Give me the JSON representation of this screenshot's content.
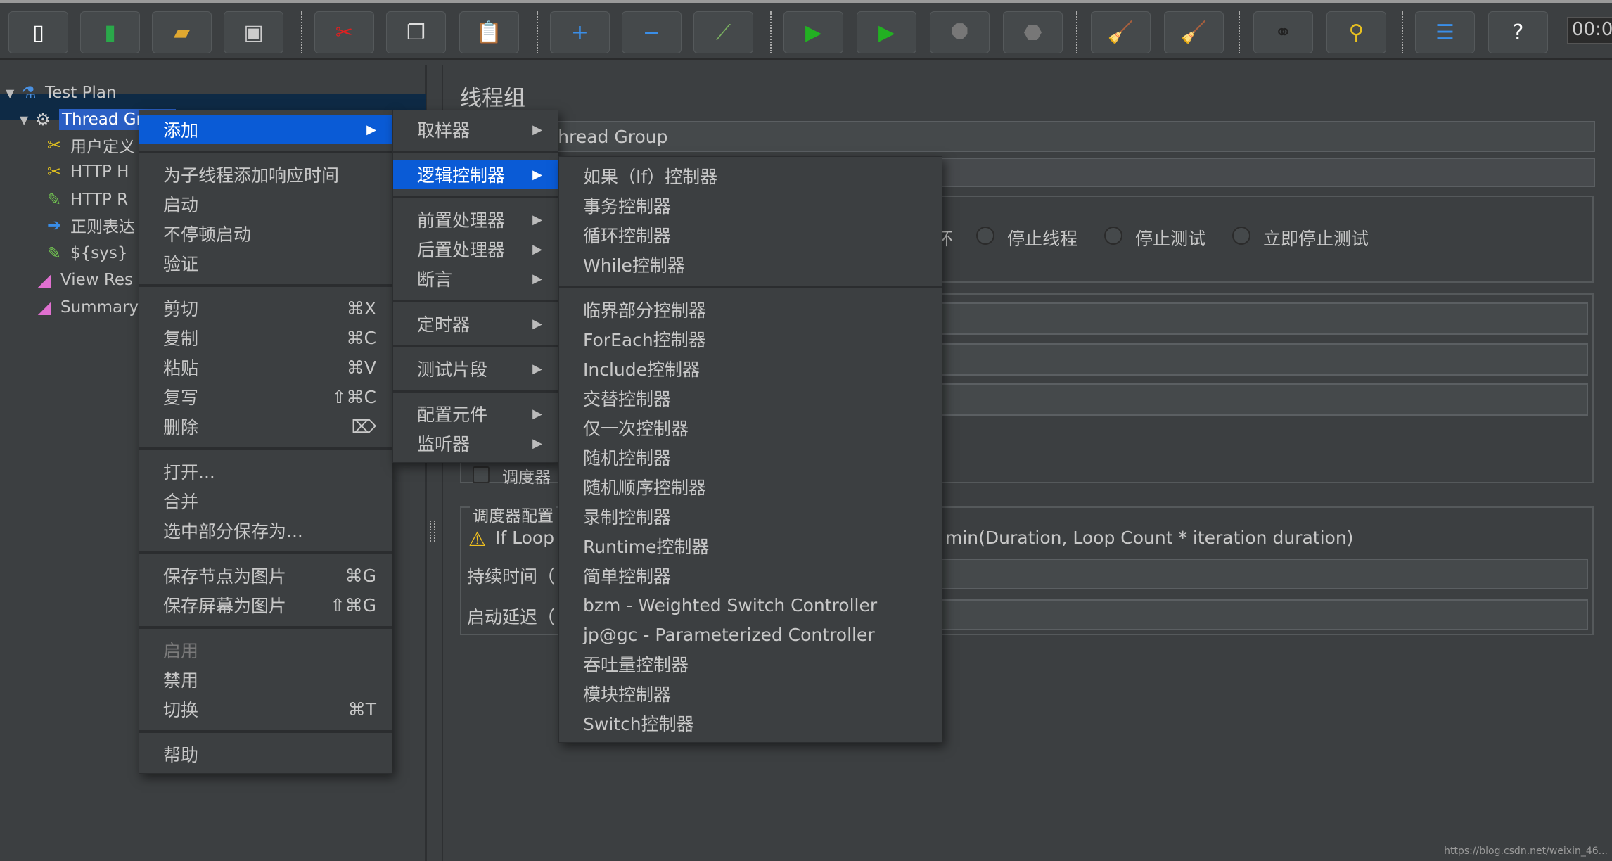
{
  "toolbar": {
    "buttons": [
      {
        "icon": "new-document-icon",
        "glyph": "▯",
        "color": "#ffffff"
      },
      {
        "icon": "templates-icon",
        "glyph": "▮",
        "color": "#2aa84a"
      },
      {
        "icon": "open-folder-icon",
        "glyph": "▰",
        "color": "#e0a830"
      },
      {
        "icon": "save-icon",
        "glyph": "▣",
        "color": "#cccccc"
      },
      {
        "icon": "cut-icon",
        "glyph": "✂",
        "color": "#e02020"
      },
      {
        "icon": "copy-icon",
        "glyph": "❐",
        "color": "#dddddd"
      },
      {
        "icon": "paste-icon",
        "glyph": "📋",
        "color": "#d08030"
      },
      {
        "icon": "expand-icon",
        "glyph": "+",
        "color": "#3a8ee8"
      },
      {
        "icon": "collapse-icon",
        "glyph": "−",
        "color": "#3a8ee8"
      },
      {
        "icon": "toggle-icon",
        "glyph": "⟋",
        "color": "#7ab060"
      },
      {
        "icon": "start-icon",
        "glyph": "▶",
        "color": "#22b022"
      },
      {
        "icon": "start-no-pause-icon",
        "glyph": "▶",
        "color": "#22b022"
      },
      {
        "icon": "stop-icon",
        "glyph": "⯃",
        "color": "#777777"
      },
      {
        "icon": "shutdown-icon",
        "glyph": "⬣",
        "color": "#777777"
      },
      {
        "icon": "clear-icon",
        "glyph": "🧹",
        "color": "#c0a070"
      },
      {
        "icon": "clear-all-icon",
        "glyph": "🧹",
        "color": "#c0a070"
      },
      {
        "icon": "search-binoculars-icon",
        "glyph": "⚭",
        "color": "#222222"
      },
      {
        "icon": "reset-search-broom-icon",
        "glyph": "⚲",
        "color": "#e8c020"
      },
      {
        "icon": "function-helper-icon",
        "glyph": "☰",
        "color": "#3a8ee8"
      },
      {
        "icon": "help-icon",
        "glyph": "?",
        "color": "#ffffff"
      }
    ],
    "timer": "00:0"
  },
  "tree": {
    "items": [
      {
        "label": "Test Plan",
        "icon": "test-plan-flask-icon"
      },
      {
        "label": "Thread Group",
        "icon": "thread-group-gear-icon"
      },
      {
        "label": "用户定义",
        "icon": "config-tools-icon"
      },
      {
        "label": "HTTP H",
        "icon": "config-tools-icon"
      },
      {
        "label": "HTTP R",
        "icon": "sampler-pipette-icon"
      },
      {
        "label": "正则表达",
        "icon": "post-processor-icon"
      },
      {
        "label": "${sys}",
        "icon": "sampler-pipette-icon"
      },
      {
        "label": "View Res",
        "icon": "listener-chart-icon"
      },
      {
        "label": "Summary",
        "icon": "listener-chart-icon"
      }
    ]
  },
  "panel": {
    "title": "线程组",
    "name_value": "Thread Group",
    "on_error_partial": "环",
    "on_error_options": [
      "停止线程",
      "停止测试",
      "立即停止测试"
    ],
    "scheduler_checkbox": "调度器",
    "scheduler_section_title": "调度器配置",
    "warning_start": "If Loop",
    "warning_end": "min(Duration, Loop Count * iteration duration)",
    "duration_label": "持续时间（",
    "delay_label": "启动延迟（"
  },
  "context_menu": {
    "groups": [
      [
        {
          "label": "添加",
          "submenu": true,
          "highlighted": true
        }
      ],
      [
        {
          "label": "为子线程添加响应时间"
        },
        {
          "label": "启动"
        },
        {
          "label": "不停顿启动"
        },
        {
          "label": "验证"
        }
      ],
      [
        {
          "label": "剪切",
          "shortcut": "⌘X"
        },
        {
          "label": "复制",
          "shortcut": "⌘C"
        },
        {
          "label": "粘贴",
          "shortcut": "⌘V"
        },
        {
          "label": "复写",
          "shortcut": "⇧⌘C"
        },
        {
          "label": "删除",
          "shortcut": "⌦"
        }
      ],
      [
        {
          "label": "打开..."
        },
        {
          "label": "合并"
        },
        {
          "label": "选中部分保存为..."
        }
      ],
      [
        {
          "label": "保存节点为图片",
          "shortcut": "⌘G"
        },
        {
          "label": "保存屏幕为图片",
          "shortcut": "⇧⌘G"
        }
      ],
      [
        {
          "label": "启用",
          "disabled": true
        },
        {
          "label": "禁用"
        },
        {
          "label": "切换",
          "shortcut": "⌘T"
        }
      ],
      [
        {
          "label": "帮助"
        }
      ]
    ]
  },
  "add_submenu": {
    "groups": [
      [
        {
          "label": "取样器",
          "submenu": true
        }
      ],
      [
        {
          "label": "逻辑控制器",
          "submenu": true,
          "highlighted": true
        }
      ],
      [
        {
          "label": "前置处理器",
          "submenu": true
        },
        {
          "label": "后置处理器",
          "submenu": true
        },
        {
          "label": "断言",
          "submenu": true
        }
      ],
      [
        {
          "label": "定时器",
          "submenu": true
        }
      ],
      [
        {
          "label": "测试片段",
          "submenu": true
        }
      ],
      [
        {
          "label": "配置元件",
          "submenu": true
        },
        {
          "label": "监听器",
          "submenu": true
        }
      ]
    ]
  },
  "logic_submenu": {
    "groups": [
      [
        {
          "label": "如果（If）控制器"
        },
        {
          "label": "事务控制器"
        },
        {
          "label": "循环控制器"
        },
        {
          "label": "While控制器"
        }
      ],
      [
        {
          "label": "临界部分控制器"
        },
        {
          "label": "ForEach控制器"
        },
        {
          "label": "Include控制器"
        },
        {
          "label": "交替控制器"
        },
        {
          "label": "仅一次控制器"
        },
        {
          "label": "随机控制器"
        },
        {
          "label": "随机顺序控制器"
        },
        {
          "label": "录制控制器"
        },
        {
          "label": "Runtime控制器"
        },
        {
          "label": "简单控制器"
        },
        {
          "label": "bzm - Weighted Switch Controller"
        },
        {
          "label": "jp@gc - Parameterized Controller"
        },
        {
          "label": "吞吐量控制器"
        },
        {
          "label": "模块控制器"
        },
        {
          "label": "Switch控制器"
        }
      ]
    ]
  },
  "watermark": "https://blog.csdn.net/weixin_46..."
}
